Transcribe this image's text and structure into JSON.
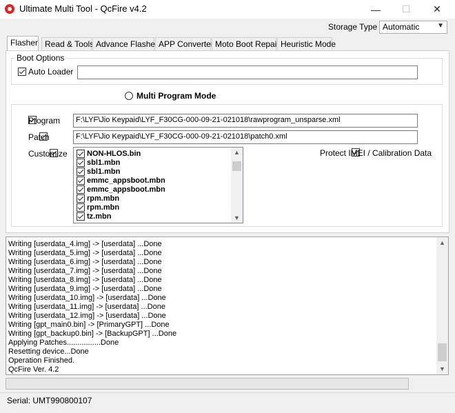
{
  "window": {
    "title": "Ultimate Multi Tool - QcFire v4.2",
    "minimize_glyph": "—",
    "maximize_glyph": "☐",
    "close_glyph": "✕",
    "app_icon": "qualcomm-logo-icon"
  },
  "storage": {
    "label": "Storage Type",
    "selected": "Automatic"
  },
  "tabs": [
    {
      "label": "Flasher",
      "active": true
    },
    {
      "label": "Read & Tools",
      "active": false
    },
    {
      "label": "Advance Flasher",
      "active": false
    },
    {
      "label": "APP Converter",
      "active": false
    },
    {
      "label": "Moto Boot Repair",
      "active": false
    },
    {
      "label": "Heuristic Mode",
      "active": false
    }
  ],
  "boot_options": {
    "group_label": "Boot Options",
    "auto_loader_label": "Auto Loader",
    "auto_loader_checked": true,
    "loader_path": ""
  },
  "multi_program": {
    "label": "Multi Program Mode",
    "selected": false
  },
  "files": {
    "program_label": "Program",
    "program_checked": true,
    "program_path": "F:\\LYF\\Jio Keypaid\\LYF_F30CG-000-09-21-021018\\rawprogram_unsparse.xml",
    "patch_label": "Patch",
    "patch_checked": true,
    "patch_path": "F:\\LYF\\Jio Keypaid\\LYF_F30CG-000-09-21-021018\\patch0.xml",
    "customize_label": "Customize",
    "customize_checked": true,
    "protect_label": "Protect IMEI / Calibration Data",
    "protect_checked": true,
    "partitions": [
      {
        "name": "NON-HLOS.bin",
        "checked": true
      },
      {
        "name": "sbl1.mbn",
        "checked": true
      },
      {
        "name": "sbl1.mbn",
        "checked": true
      },
      {
        "name": "emmc_appsboot.mbn",
        "checked": true
      },
      {
        "name": "emmc_appsboot.mbn",
        "checked": true
      },
      {
        "name": "rpm.mbn",
        "checked": true
      },
      {
        "name": "rpm.mbn",
        "checked": true
      },
      {
        "name": "tz.mbn",
        "checked": true
      }
    ]
  },
  "log": {
    "lines": [
      "Writing [userdata_4.img] -> [userdata] ...Done",
      "Writing [userdata_5.img] -> [userdata] ...Done",
      "Writing [userdata_6.img] -> [userdata] ...Done",
      "Writing [userdata_7.img] -> [userdata] ...Done",
      "Writing [userdata_8.img] -> [userdata] ...Done",
      "Writing [userdata_9.img] -> [userdata] ...Done",
      "Writing [userdata_10.img] -> [userdata] ...Done",
      "Writing [userdata_11.img] -> [userdata] ...Done",
      "Writing [userdata_12.img] -> [userdata] ...Done",
      "Writing [gpt_main0.bin] -> [PrimaryGPT] ...Done",
      "Writing [gpt_backup0.bin] -> [BackupGPT] ...Done",
      "Applying Patches................Done",
      "Resetting device...Done",
      "Operation Finished.",
      "QcFire Ver. 4.2"
    ]
  },
  "progress": {
    "value": 0
  },
  "status": {
    "serial": "Serial: UMT990800107"
  }
}
